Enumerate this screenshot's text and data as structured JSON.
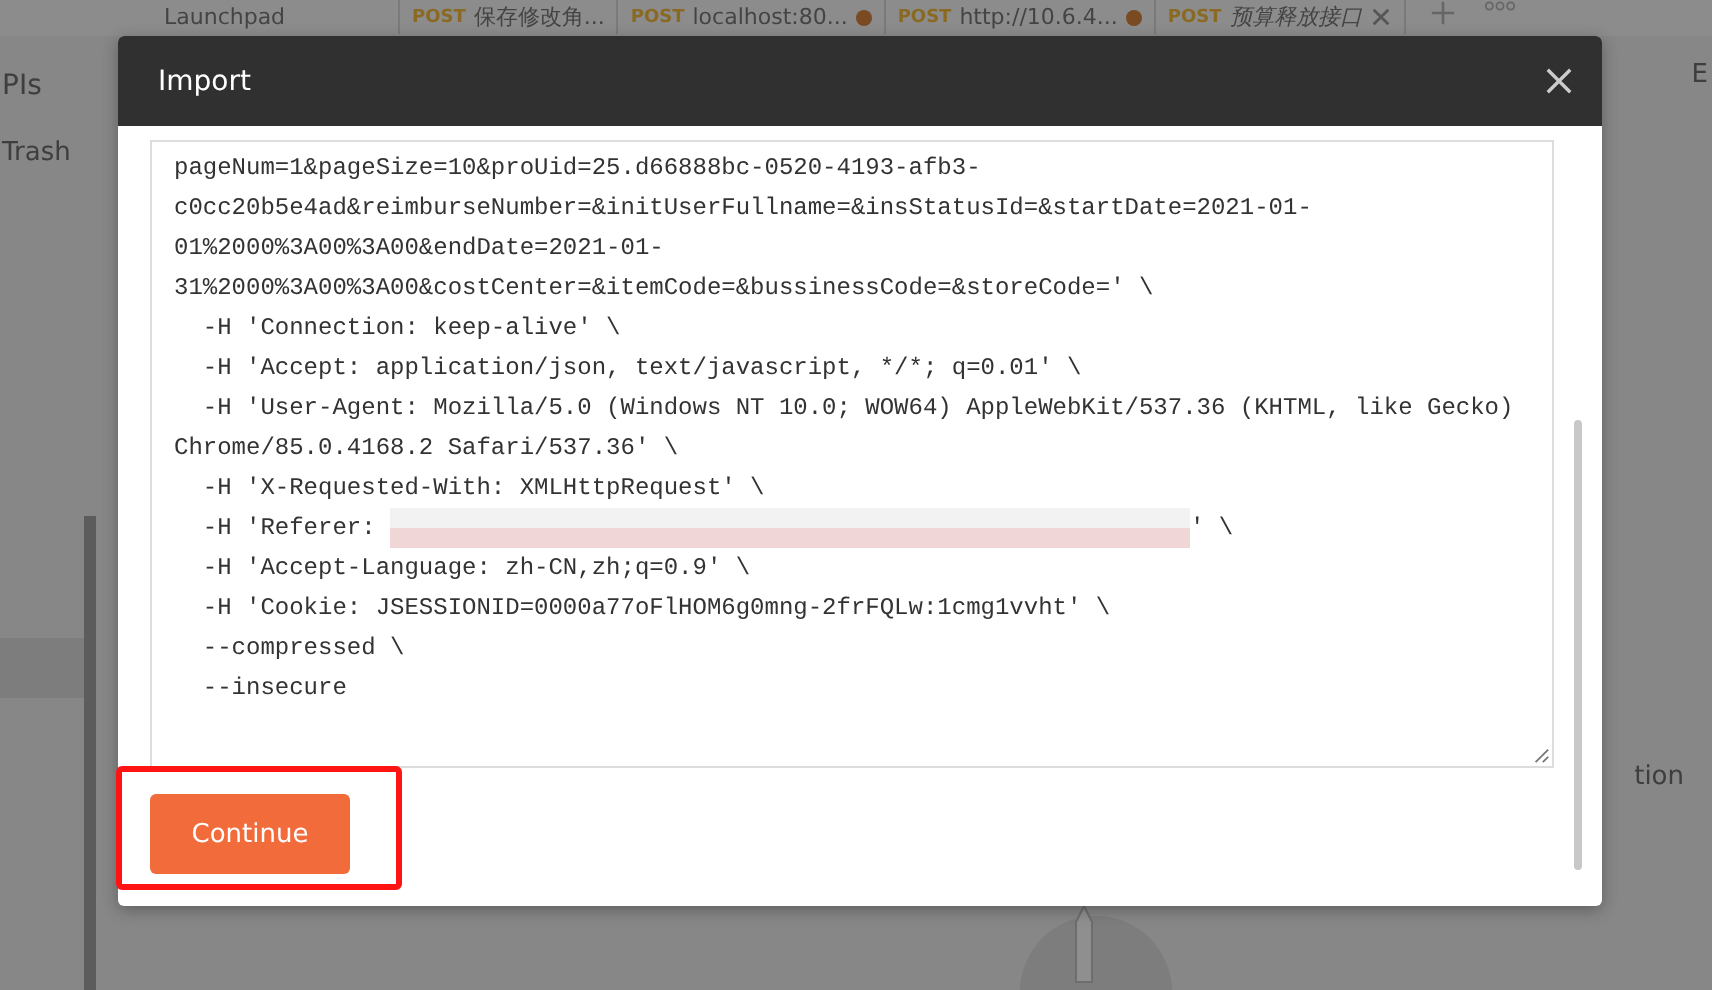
{
  "background_tabs": [
    {
      "label": "Launchpad",
      "unsaved": false,
      "italic": false,
      "closable": false
    },
    {
      "method": "POST",
      "label": "保存修改角...",
      "unsaved": false,
      "italic": false,
      "closable": false
    },
    {
      "method": "POST",
      "label": "localhost:80...",
      "unsaved": true,
      "italic": false,
      "closable": false
    },
    {
      "method": "POST",
      "label": "http://10.6.4...",
      "unsaved": true,
      "italic": false,
      "closable": false
    },
    {
      "method": "POST",
      "label": "预算释放接口",
      "unsaved": false,
      "italic": true,
      "closable": true
    }
  ],
  "sidebar": {
    "items": [
      "PIs",
      "Trash"
    ]
  },
  "right_texts": [
    "E",
    "tion"
  ],
  "dialog": {
    "title": "Import",
    "lines": [
      {
        "kind": "text",
        "text": "pageNum=1&pageSize=10&proUid=25.d66888bc-0520-4193-afb3-"
      },
      {
        "kind": "text",
        "text": "c0cc20b5e4ad&reimburseNumber=&initUserFullname=&insStatusId=&startDate=2021-01-"
      },
      {
        "kind": "text",
        "text": "01%2000%3A00%3A00&endDate=2021-01-"
      },
      {
        "kind": "text",
        "text": "31%2000%3A00%3A00&costCenter=&itemCode=&bussinessCode=&storeCode=' \\"
      },
      {
        "kind": "text",
        "text": "  -H 'Connection: keep-alive' \\"
      },
      {
        "kind": "text",
        "text": "  -H 'Accept: application/json, text/javascript, */*; q=0.01' \\"
      },
      {
        "kind": "text",
        "text": "  -H 'User-Agent: Mozilla/5.0 (Windows NT 10.0; WOW64) AppleWebKit/537.36 (KHTML, like Gecko)"
      },
      {
        "kind": "text",
        "text": "Chrome/85.0.4168.2 Safari/537.36' \\"
      },
      {
        "kind": "text",
        "text": "  -H 'X-Requested-With: XMLHttpRequest' \\"
      },
      {
        "kind": "redacted",
        "before": "  -H 'Referer: ",
        "after": "' \\"
      },
      {
        "kind": "text",
        "text": "  -H 'Accept-Language: zh-CN,zh;q=0.9' \\"
      },
      {
        "kind": "text",
        "text": "  -H 'Cookie: JSESSIONID=0000a77oFlHOM6g0mng-2frFQLw:1cmg1vvht' \\"
      },
      {
        "kind": "text",
        "text": "  --compressed \\"
      },
      {
        "kind": "text",
        "text": "  --insecure"
      }
    ],
    "button": "Continue",
    "button_highlighted": true
  }
}
